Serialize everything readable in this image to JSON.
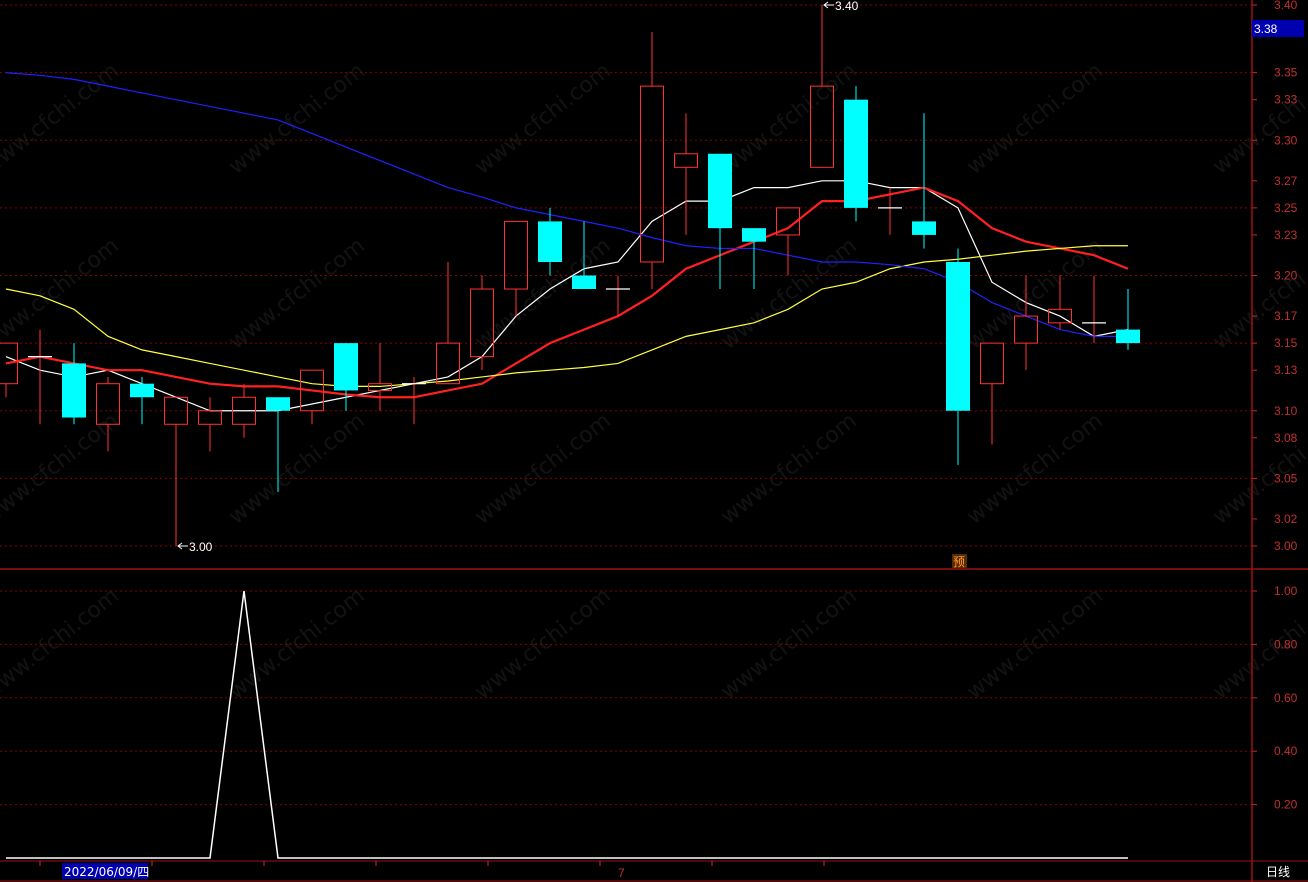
{
  "colors": {
    "background": "#000000",
    "up": "#ff3232",
    "down": "#00ffff",
    "grid": "#8b0000",
    "axis_text": "#c03030",
    "ma5": "#ffffff",
    "ma10": "#ff2020",
    "ma20": "#ffff40",
    "ma60": "#2020ff",
    "indicator": "#ffffff",
    "price_tag_bg": "#0000b0",
    "date_tag_bg": "#0000b0"
  },
  "watermark_text": "www.cfchi.com",
  "price_tag": "3.38",
  "date_label": "2022/06/09/四",
  "period_label": "日线",
  "month_marker": "7",
  "badge": "预",
  "labels": {
    "high": "3.40",
    "low": "3.00"
  },
  "chart_data": [
    {
      "type": "candlestick",
      "y_ticks": [
        "3.40",
        "3.38",
        "3.35",
        "3.33",
        "3.30",
        "3.27",
        "3.25",
        "3.23",
        "3.20",
        "3.17",
        "3.15",
        "3.13",
        "3.10",
        "3.08",
        "3.05",
        "3.02",
        "3.00"
      ],
      "ylim": [
        3.0,
        3.4
      ],
      "annotations": [
        {
          "text": "3.40",
          "index": 24,
          "value": 3.4
        },
        {
          "text": "3.00",
          "index": 5,
          "value": 3.0
        }
      ],
      "candles": [
        {
          "open": 3.12,
          "close": 3.15,
          "high": 3.15,
          "low": 3.11
        },
        {
          "open": 3.14,
          "close": 3.14,
          "high": 3.16,
          "low": 3.09
        },
        {
          "open": 3.135,
          "close": 3.095,
          "high": 3.15,
          "low": 3.09
        },
        {
          "open": 3.09,
          "close": 3.12,
          "high": 3.125,
          "low": 3.07
        },
        {
          "open": 3.12,
          "close": 3.11,
          "high": 3.125,
          "low": 3.09
        },
        {
          "open": 3.09,
          "close": 3.11,
          "high": 3.11,
          "low": 3.0
        },
        {
          "open": 3.09,
          "close": 3.1,
          "high": 3.11,
          "low": 3.07
        },
        {
          "open": 3.09,
          "close": 3.11,
          "high": 3.12,
          "low": 3.08
        },
        {
          "open": 3.11,
          "close": 3.1,
          "high": 3.11,
          "low": 3.04
        },
        {
          "open": 3.1,
          "close": 3.13,
          "high": 3.13,
          "low": 3.09
        },
        {
          "open": 3.15,
          "close": 3.115,
          "high": 3.15,
          "low": 3.1
        },
        {
          "open": 3.115,
          "close": 3.12,
          "high": 3.15,
          "low": 3.1
        },
        {
          "open": 3.12,
          "close": 3.12,
          "high": 3.125,
          "low": 3.09
        },
        {
          "open": 3.12,
          "close": 3.15,
          "high": 3.21,
          "low": 3.12
        },
        {
          "open": 3.14,
          "close": 3.19,
          "high": 3.2,
          "low": 3.13
        },
        {
          "open": 3.19,
          "close": 3.24,
          "high": 3.24,
          "low": 3.17
        },
        {
          "open": 3.24,
          "close": 3.21,
          "high": 3.25,
          "low": 3.2
        },
        {
          "open": 3.2,
          "close": 3.19,
          "high": 3.24,
          "low": 3.19
        },
        {
          "open": 3.19,
          "close": 3.19,
          "high": 3.2,
          "low": 3.17
        },
        {
          "open": 3.21,
          "close": 3.34,
          "high": 3.38,
          "low": 3.19
        },
        {
          "open": 3.28,
          "close": 3.29,
          "high": 3.32,
          "low": 3.23
        },
        {
          "open": 3.29,
          "close": 3.235,
          "high": 3.29,
          "low": 3.19
        },
        {
          "open": 3.235,
          "close": 3.225,
          "high": 3.235,
          "low": 3.19
        },
        {
          "open": 3.23,
          "close": 3.25,
          "high": 3.25,
          "low": 3.2
        },
        {
          "open": 3.28,
          "close": 3.34,
          "high": 3.4,
          "low": 3.28
        },
        {
          "open": 3.33,
          "close": 3.25,
          "high": 3.34,
          "low": 3.24
        },
        {
          "open": 3.25,
          "close": 3.25,
          "high": 3.265,
          "low": 3.23
        },
        {
          "open": 3.24,
          "close": 3.23,
          "high": 3.32,
          "low": 3.22
        },
        {
          "open": 3.21,
          "close": 3.1,
          "high": 3.22,
          "low": 3.06
        },
        {
          "open": 3.12,
          "close": 3.15,
          "high": 3.15,
          "low": 3.075
        },
        {
          "open": 3.15,
          "close": 3.17,
          "high": 3.2,
          "low": 3.13
        },
        {
          "open": 3.165,
          "close": 3.175,
          "high": 3.2,
          "low": 3.16
        },
        {
          "open": 3.165,
          "close": 3.165,
          "high": 3.2,
          "low": 3.15
        },
        {
          "open": 3.16,
          "close": 3.15,
          "high": 3.19,
          "low": 3.145
        }
      ],
      "series": [
        {
          "key": "ma5",
          "values": [
            3.14,
            3.13,
            3.125,
            3.13,
            3.12,
            3.11,
            3.1,
            3.1,
            3.1,
            3.105,
            3.11,
            3.115,
            3.12,
            3.125,
            3.14,
            3.17,
            3.19,
            3.205,
            3.21,
            3.24,
            3.255,
            3.255,
            3.265,
            3.265,
            3.27,
            3.27,
            3.265,
            3.265,
            3.25,
            3.195,
            3.18,
            3.17,
            3.155,
            3.16
          ]
        },
        {
          "key": "ma10",
          "values": [
            3.135,
            3.14,
            3.135,
            3.13,
            3.13,
            3.125,
            3.12,
            3.118,
            3.118,
            3.115,
            3.112,
            3.11,
            3.11,
            3.115,
            3.12,
            3.135,
            3.15,
            3.16,
            3.17,
            3.185,
            3.205,
            3.215,
            3.225,
            3.235,
            3.255,
            3.255,
            3.26,
            3.265,
            3.255,
            3.235,
            3.225,
            3.22,
            3.215,
            3.205
          ]
        },
        {
          "key": "ma20",
          "values": [
            3.19,
            3.185,
            3.175,
            3.155,
            3.145,
            3.14,
            3.135,
            3.13,
            3.125,
            3.12,
            3.118,
            3.118,
            3.12,
            3.122,
            3.125,
            3.128,
            3.13,
            3.132,
            3.135,
            3.145,
            3.155,
            3.16,
            3.165,
            3.175,
            3.19,
            3.195,
            3.205,
            3.21,
            3.212,
            3.215,
            3.218,
            3.22,
            3.222,
            3.222
          ]
        },
        {
          "key": "ma60",
          "values": [
            3.35,
            3.348,
            3.345,
            3.34,
            3.335,
            3.33,
            3.325,
            3.32,
            3.315,
            3.305,
            3.295,
            3.285,
            3.275,
            3.265,
            3.258,
            3.25,
            3.245,
            3.24,
            3.235,
            3.228,
            3.222,
            3.22,
            3.22,
            3.215,
            3.21,
            3.21,
            3.208,
            3.205,
            3.195,
            3.18,
            3.17,
            3.16,
            3.155,
            3.155
          ]
        }
      ]
    },
    {
      "type": "line",
      "y_ticks": [
        "1.00",
        "0.80",
        "0.60",
        "0.40",
        "0.20"
      ],
      "ylim": [
        0,
        1.0
      ],
      "values": [
        0,
        0,
        0,
        0,
        0,
        0,
        0,
        1,
        0,
        0,
        0,
        0,
        0,
        0,
        0,
        0,
        0,
        0,
        0,
        0,
        0,
        0,
        0,
        0,
        0,
        0,
        0,
        0,
        0,
        0,
        0,
        0,
        0,
        0
      ]
    }
  ]
}
